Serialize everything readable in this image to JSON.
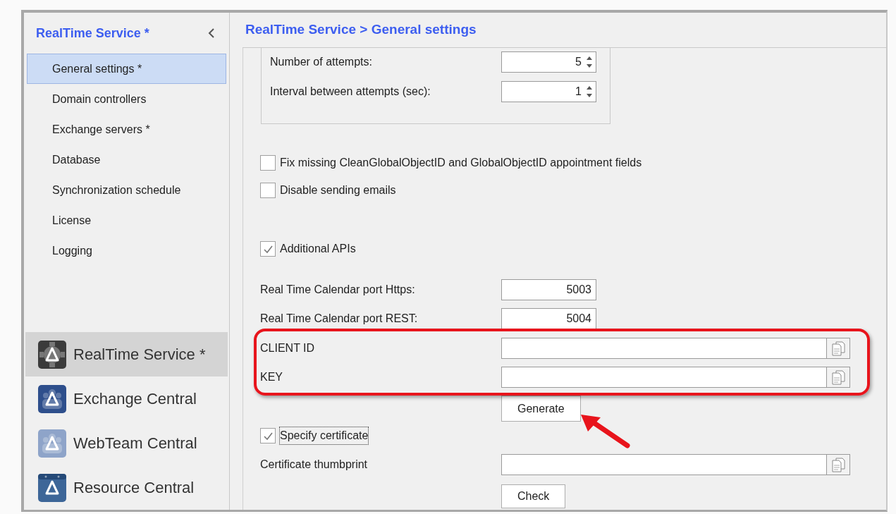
{
  "sidebar": {
    "title": "RealTime Service *",
    "items": [
      {
        "label": "General settings *",
        "selected": true
      },
      {
        "label": "Domain controllers",
        "selected": false
      },
      {
        "label": "Exchange servers *",
        "selected": false
      },
      {
        "label": "Database",
        "selected": false
      },
      {
        "label": "Synchronization schedule",
        "selected": false
      },
      {
        "label": "License",
        "selected": false
      },
      {
        "label": "Logging",
        "selected": false
      }
    ],
    "apps": [
      {
        "label": "RealTime Service *",
        "kind": "gear",
        "color": "#3b3b3b",
        "selected": true
      },
      {
        "label": "Exchange Central",
        "kind": "people",
        "color": "#2e4f8c",
        "selected": false
      },
      {
        "label": "WebTeam Central",
        "kind": "people",
        "color": "#8ea4c9",
        "selected": false
      },
      {
        "label": "Resource Central",
        "kind": "calendar",
        "color": "#3d6698",
        "selected": false
      }
    ]
  },
  "main": {
    "title": "RealTime Service > General settings",
    "retry_group": [
      {
        "label": "Number of attempts:",
        "value": "5"
      },
      {
        "label": "Interval between attempts (sec):",
        "value": "1"
      }
    ],
    "rows": [
      {
        "kind": "checkbox",
        "label": "Fix missing CleanGlobalObjectID and GlobalObjectID appointment fields",
        "checked": false
      },
      {
        "kind": "checkbox",
        "label": "Disable sending emails",
        "checked": false
      },
      {
        "kind": "checkbox",
        "label": "Additional APIs",
        "checked": true
      },
      {
        "kind": "number",
        "label": "Real Time Calendar port Https:",
        "value": "5003"
      },
      {
        "kind": "number",
        "label": "Real Time Calendar port REST:",
        "value": "5004"
      },
      {
        "kind": "copy_field",
        "label": "CLIENT ID"
      },
      {
        "kind": "copy_field",
        "label": "KEY"
      },
      {
        "kind": "button",
        "label": "Generate"
      },
      {
        "kind": "checkbox",
        "label": "Specify certificate",
        "checked": true,
        "focused": true
      },
      {
        "kind": "copy_field",
        "label": "Certificate thumbprint"
      },
      {
        "kind": "button",
        "label": "Check"
      }
    ]
  }
}
